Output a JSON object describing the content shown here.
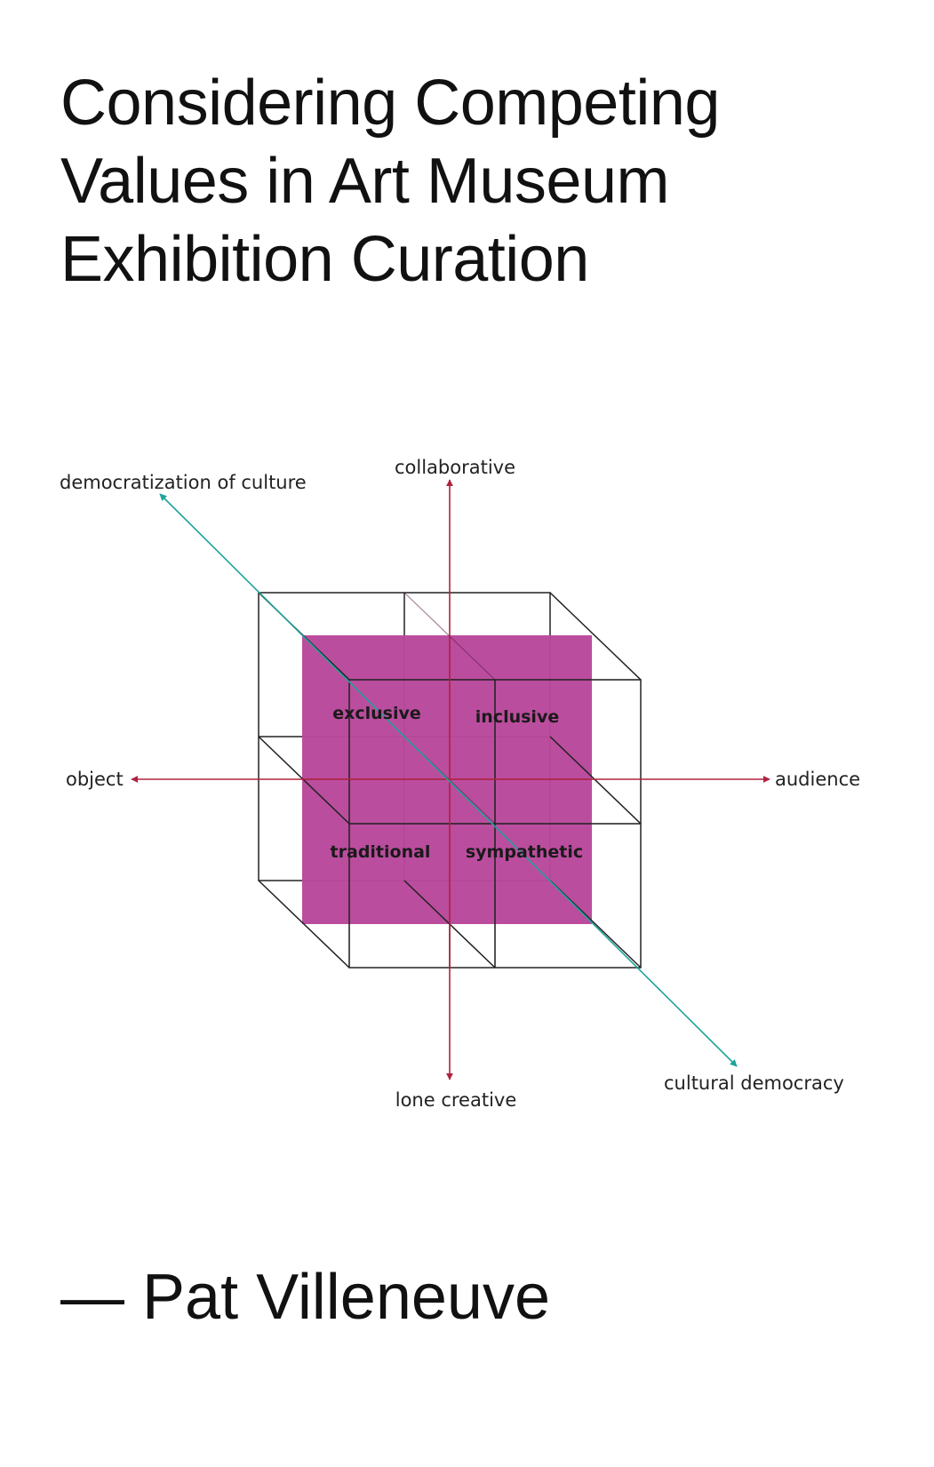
{
  "title": {
    "line1": "Considering Competing",
    "line2": "Values in Art Museum",
    "line3": "Exhibition Curation"
  },
  "diagram": {
    "axis_labels": {
      "top": "collaborative",
      "bottom": "lone creative",
      "left": "object",
      "right": "audience",
      "diag_top": "democratization of culture",
      "diag_bottom": "cultural democracy"
    },
    "quadrants": {
      "top_left": "exclusive",
      "top_right": "inclusive",
      "bottom_left": "traditional",
      "bottom_right": "sympathetic"
    },
    "colors": {
      "magenta_face": "#b9479b",
      "axis_red": "#b0223f",
      "axis_teal": "#1fa39a",
      "cube_lines": "#222222"
    }
  },
  "author": {
    "dash": "—",
    "name": "Pat Villeneuve"
  }
}
